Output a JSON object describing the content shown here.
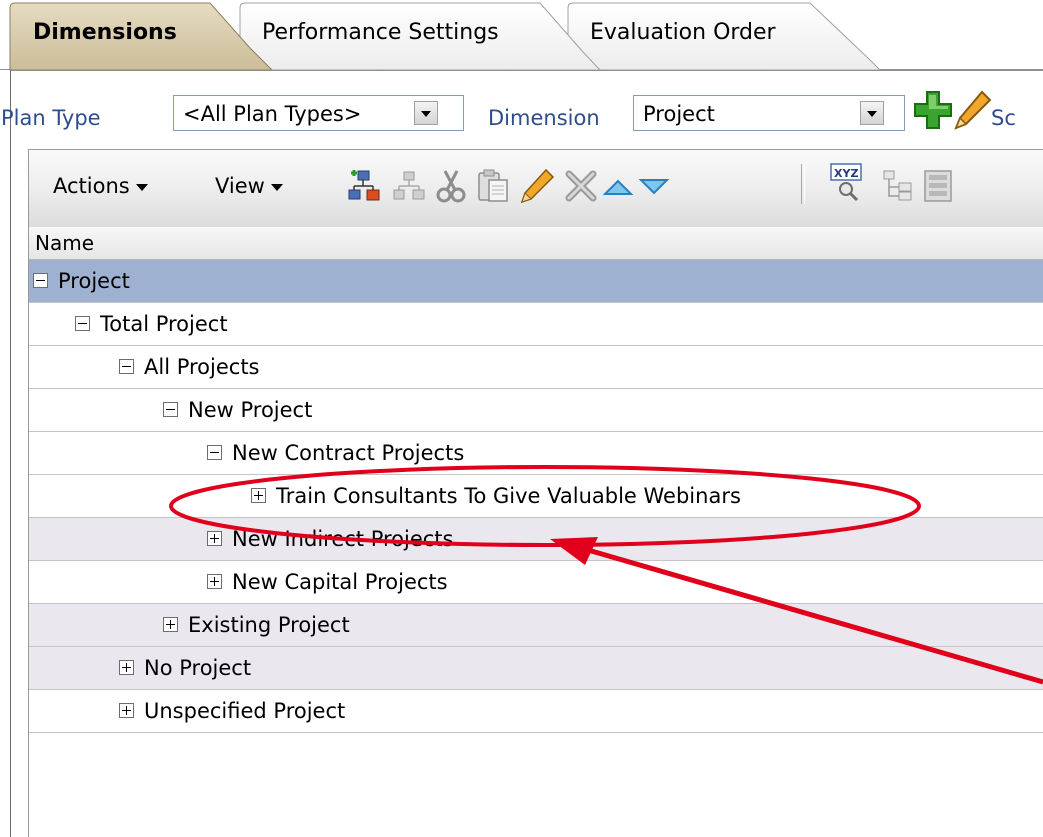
{
  "tabs": [
    {
      "label": "Dimensions"
    },
    {
      "label": "Performance Settings"
    },
    {
      "label": "Evaluation Order"
    }
  ],
  "filters": {
    "plan_type_label": "Plan Type",
    "plan_type_value": "<All Plan Types>",
    "dimension_label": "Dimension",
    "dimension_value": "Project",
    "truncated_label": "Sc"
  },
  "toolbar": {
    "actions_label": "Actions",
    "view_label": "View",
    "icons": [
      "add-child-icon",
      "add-sibling-icon",
      "cut-icon",
      "paste-icon",
      "edit-icon",
      "delete-icon",
      "move-up-icon",
      "move-down-icon",
      "search-icon",
      "tree-view-icon",
      "properties-icon"
    ]
  },
  "table": {
    "header": "Name",
    "rows": [
      {
        "label": "Project",
        "toggle": "minus"
      },
      {
        "label": "Total Project",
        "toggle": "minus"
      },
      {
        "label": "All Projects",
        "toggle": "minus"
      },
      {
        "label": "New Project",
        "toggle": "minus"
      },
      {
        "label": "New Contract Projects",
        "toggle": "minus"
      },
      {
        "label": "Train Consultants To Give Valuable Webinars",
        "toggle": "plus"
      },
      {
        "label": "New Indirect Projects",
        "toggle": "plus"
      },
      {
        "label": "New Capital Projects",
        "toggle": "plus"
      },
      {
        "label": "Existing Project",
        "toggle": "plus"
      },
      {
        "label": "No Project",
        "toggle": "plus"
      },
      {
        "label": "Unspecified Project",
        "toggle": "plus"
      }
    ]
  },
  "colors": {
    "selected_row": "#9eb1d0",
    "alt_row": "#ebe7ee",
    "annotation": "#e0001b",
    "label_blue": "#2e4d8c",
    "active_tab": "#d6c9a8"
  }
}
